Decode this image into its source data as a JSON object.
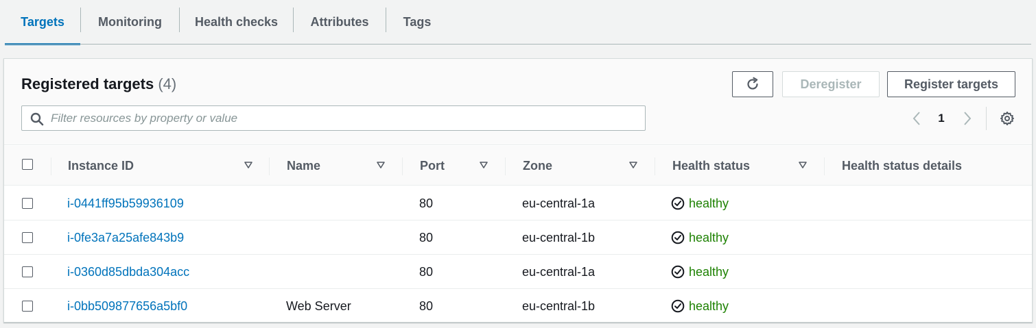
{
  "tabs": [
    {
      "label": "Targets",
      "active": true
    },
    {
      "label": "Monitoring",
      "active": false
    },
    {
      "label": "Health checks",
      "active": false
    },
    {
      "label": "Attributes",
      "active": false
    },
    {
      "label": "Tags",
      "active": false
    }
  ],
  "panel": {
    "title": "Registered targets",
    "count": "(4)",
    "deregister_label": "Deregister",
    "register_label": "Register targets",
    "refresh_icon": "refresh-icon",
    "search_placeholder": "Filter resources by property or value",
    "search_value": "",
    "page": "1"
  },
  "table": {
    "columns": [
      "Instance ID",
      "Name",
      "Port",
      "Zone",
      "Health status",
      "Health status details"
    ],
    "rows": [
      {
        "instance_id": "i-0441ff95b59936109",
        "name": "",
        "port": "80",
        "zone": "eu-central-1a",
        "health": "healthy",
        "details": ""
      },
      {
        "instance_id": "i-0fe3a7a25afe843b9",
        "name": "",
        "port": "80",
        "zone": "eu-central-1b",
        "health": "healthy",
        "details": ""
      },
      {
        "instance_id": "i-0360d85dbda304acc",
        "name": "",
        "port": "80",
        "zone": "eu-central-1a",
        "health": "healthy",
        "details": ""
      },
      {
        "instance_id": "i-0bb509877656a5bf0",
        "name": "Web Server",
        "port": "80",
        "zone": "eu-central-1b",
        "health": "healthy",
        "details": ""
      }
    ]
  },
  "colors": {
    "accent": "#0073bb",
    "healthy": "#1d8102",
    "text": "#16191f",
    "muted": "#545b64"
  }
}
